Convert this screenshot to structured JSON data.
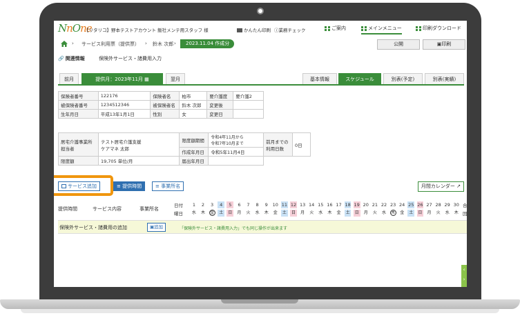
{
  "header": {
    "logo": "NnOne",
    "account": "【リタリコ】野本テストアカウント 飯社メンテ用スタッフ 様",
    "print_easy": "かんたん印刷",
    "work_check": "業務チェック",
    "guide": "ご案内",
    "main_menu": "メインメニュー",
    "print_download": "印刷ダウンロード"
  },
  "breadcrumb": {
    "page": "サービス利用票（提供票）",
    "person": "鈴木 次郎",
    "date_created": "2023.11.04 作成分",
    "publish": "公開",
    "print": "印刷"
  },
  "related": {
    "label": "関連情報",
    "link": "保険外サービス・諸費用入力"
  },
  "tabs": {
    "prev_month": "前月",
    "current_month": "提供月：2023年11月",
    "next_month": "翌月",
    "right": [
      "基本情報",
      "スケジュール",
      "別表(予定)",
      "別表(実績)"
    ]
  },
  "info": {
    "r1": {
      "k1": "保険者番号",
      "v1": "122176",
      "k2": "保険者名",
      "v2": "柏市",
      "k3": "要介護度",
      "v3": "要介護2"
    },
    "r2": {
      "k1": "被保険者番号",
      "v1": "1234512346",
      "k2": "被保険者名",
      "v2": "鈴木 次郎",
      "k3": "変更後"
    },
    "r3": {
      "k1": "生年月日",
      "v1": "平成13年1月1日",
      "k2": "性別",
      "v2": "女",
      "k3": "変更日"
    },
    "care_office_label": "居宅介護事業所\n担当者",
    "care_office_label1": "居宅介護事業所",
    "care_office_label2": "担当者",
    "care_office_value1": "テスト居宅介護支援",
    "care_office_value2": "ケアマネ 太郎",
    "limit_period_label": "限度額期間",
    "limit_period_value1": "令和4年11月から",
    "limit_period_value2": "令和7年10月まで",
    "created_label": "作成年月日",
    "created_value": "令和5年11月4日",
    "prev_days_label1": "前月までの",
    "prev_days_label2": "利用日数",
    "prev_days_value": "0日",
    "limit_label": "限度額",
    "limit_value": "19,705 単位/月",
    "submit_label": "届出年月日"
  },
  "actions": {
    "add_service": "サービス追加",
    "provide_time": "提供時間",
    "office_name": "事業所名",
    "monthly_calendar": "月間カレンダー"
  },
  "schedule": {
    "col_time": "提供時間",
    "col_service": "サービス内容",
    "col_office": "事業所名",
    "date_label": "日付",
    "weekday_label": "曜日",
    "days": [
      "1",
      "2",
      "3",
      "4",
      "5",
      "6",
      "7",
      "8",
      "9",
      "10",
      "11",
      "12",
      "13",
      "14",
      "15",
      "16",
      "17",
      "18",
      "19",
      "20",
      "21",
      "22",
      "23",
      "24",
      "25",
      "26",
      "27",
      "28",
      "29",
      "30"
    ],
    "weekdays": [
      "水",
      "木",
      "金",
      "土",
      "日",
      "月",
      "火",
      "水",
      "木",
      "金",
      "土",
      "日",
      "月",
      "火",
      "水",
      "木",
      "金",
      "土",
      "日",
      "月",
      "火",
      "水",
      "木",
      "金",
      "土",
      "日",
      "月",
      "火",
      "水",
      "木"
    ],
    "total_label": "合",
    "total_sub": "回",
    "extra_row_label": "保険外サービス・諸費用の追加",
    "extra_row_add": "追加",
    "extra_row_note": "「保険外サービス・諸費用入力」でも同じ操作が出来ます"
  },
  "colors": {
    "green": "#3a8d3a",
    "blue": "#2f6fb0",
    "orange": "#f0960e"
  }
}
